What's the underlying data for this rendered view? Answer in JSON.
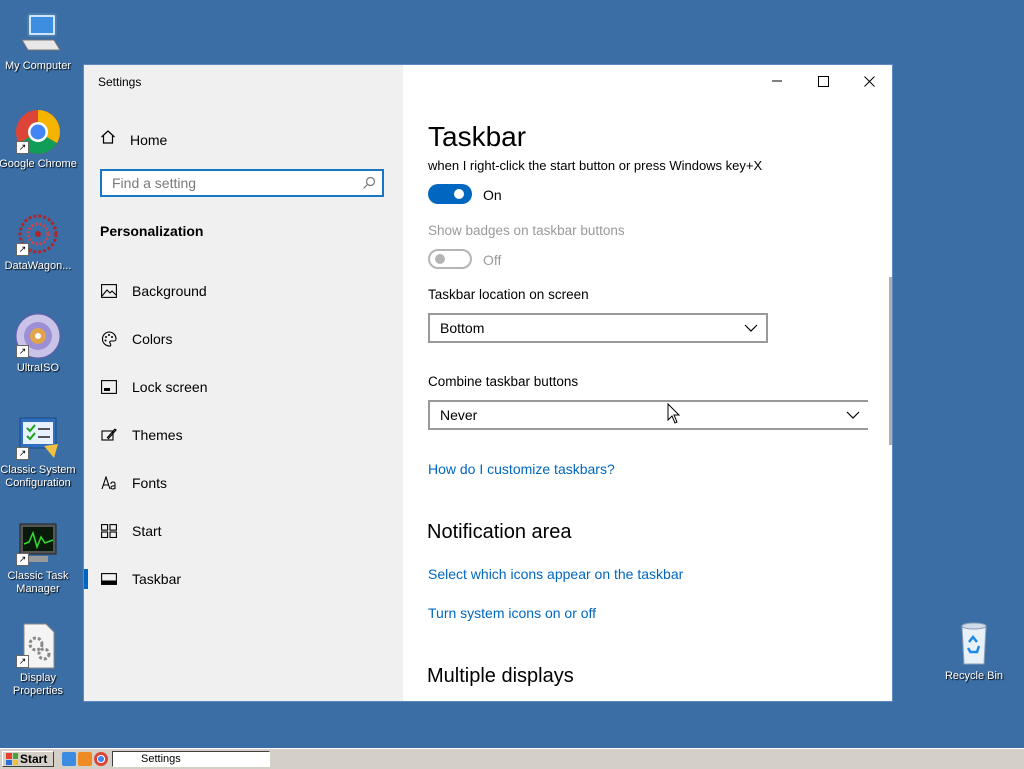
{
  "desktop": {
    "icons": [
      {
        "label": "My Computer",
        "icon": "computer-icon"
      },
      {
        "label": "Google Chrome",
        "icon": "chrome-icon"
      },
      {
        "label": "DataWagon...",
        "icon": "datawagon-icon"
      },
      {
        "label": "UltraISO",
        "icon": "disc-icon"
      },
      {
        "label": "Classic System Configuration",
        "icon": "system-config-icon"
      },
      {
        "label": "Classic Task Manager",
        "icon": "task-manager-icon"
      },
      {
        "label": "Display Properties",
        "icon": "display-properties-icon"
      },
      {
        "label": "Recycle Bin",
        "icon": "recycle-bin-icon"
      }
    ]
  },
  "window": {
    "title": "Settings",
    "controls": {
      "minimize": "minimize-icon",
      "maximize": "maximize-icon",
      "close": "close-icon"
    }
  },
  "sidebar": {
    "home_label": "Home",
    "search_placeholder": "Find a setting",
    "section": "Personalization",
    "items": [
      {
        "label": "Background",
        "icon": "image-icon"
      },
      {
        "label": "Colors",
        "icon": "palette-icon"
      },
      {
        "label": "Lock screen",
        "icon": "lock-screen-icon"
      },
      {
        "label": "Themes",
        "icon": "brush-icon"
      },
      {
        "label": "Fonts",
        "icon": "font-icon"
      },
      {
        "label": "Start",
        "icon": "start-icon"
      },
      {
        "label": "Taskbar",
        "icon": "taskbar-icon",
        "active": true
      }
    ]
  },
  "content": {
    "page_title": "Taskbar",
    "clipped_text": "when I right-click the start button or press Windows key+X",
    "toggle1": {
      "state_label": "On",
      "on": true
    },
    "badges_label": "Show badges on taskbar buttons",
    "toggle2": {
      "state_label": "Off",
      "on": false
    },
    "location_label": "Taskbar location on screen",
    "location_value": "Bottom",
    "combine_label": "Combine taskbar buttons",
    "combine_value": "Never",
    "customize_link": "How do I customize taskbars?",
    "notification_heading": "Notification area",
    "select_icons_link": "Select which icons appear on the taskbar",
    "system_icons_link": "Turn system icons on or off",
    "multiple_displays_heading": "Multiple displays"
  },
  "taskbar": {
    "start_label": "Start",
    "task_label": "Settings"
  },
  "colors": {
    "accent": "#0067c0",
    "desktop": "#3a6ea5",
    "sidebar": "#f0f0f0"
  }
}
